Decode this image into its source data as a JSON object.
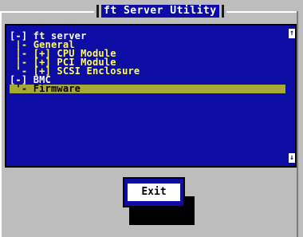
{
  "window": {
    "title": "ft Server Utility"
  },
  "tree": {
    "rows": [
      {
        "text": "[-] ft server",
        "level": "top"
      },
      {
        "text": " |- General",
        "level": "child"
      },
      {
        "text": " |- [+] CPU Module",
        "level": "child"
      },
      {
        "text": " |- [+] PCI Module",
        "level": "child"
      },
      {
        "text": " '- [+] SCSI Enclosure",
        "level": "child"
      },
      {
        "text": "[-] BMC",
        "level": "top"
      },
      {
        "text": " '- Firmware",
        "level": "child",
        "selected": true
      }
    ]
  },
  "scrollbar": {
    "up_glyph": "↑",
    "down_glyph": "↓"
  },
  "exit_button": {
    "label": "Exit"
  },
  "colors": {
    "background": "#bdbdbd",
    "panel": "#0d0da6",
    "text_top": "#ffffff",
    "text_child": "#ffff55",
    "selection": "#a8a834"
  }
}
